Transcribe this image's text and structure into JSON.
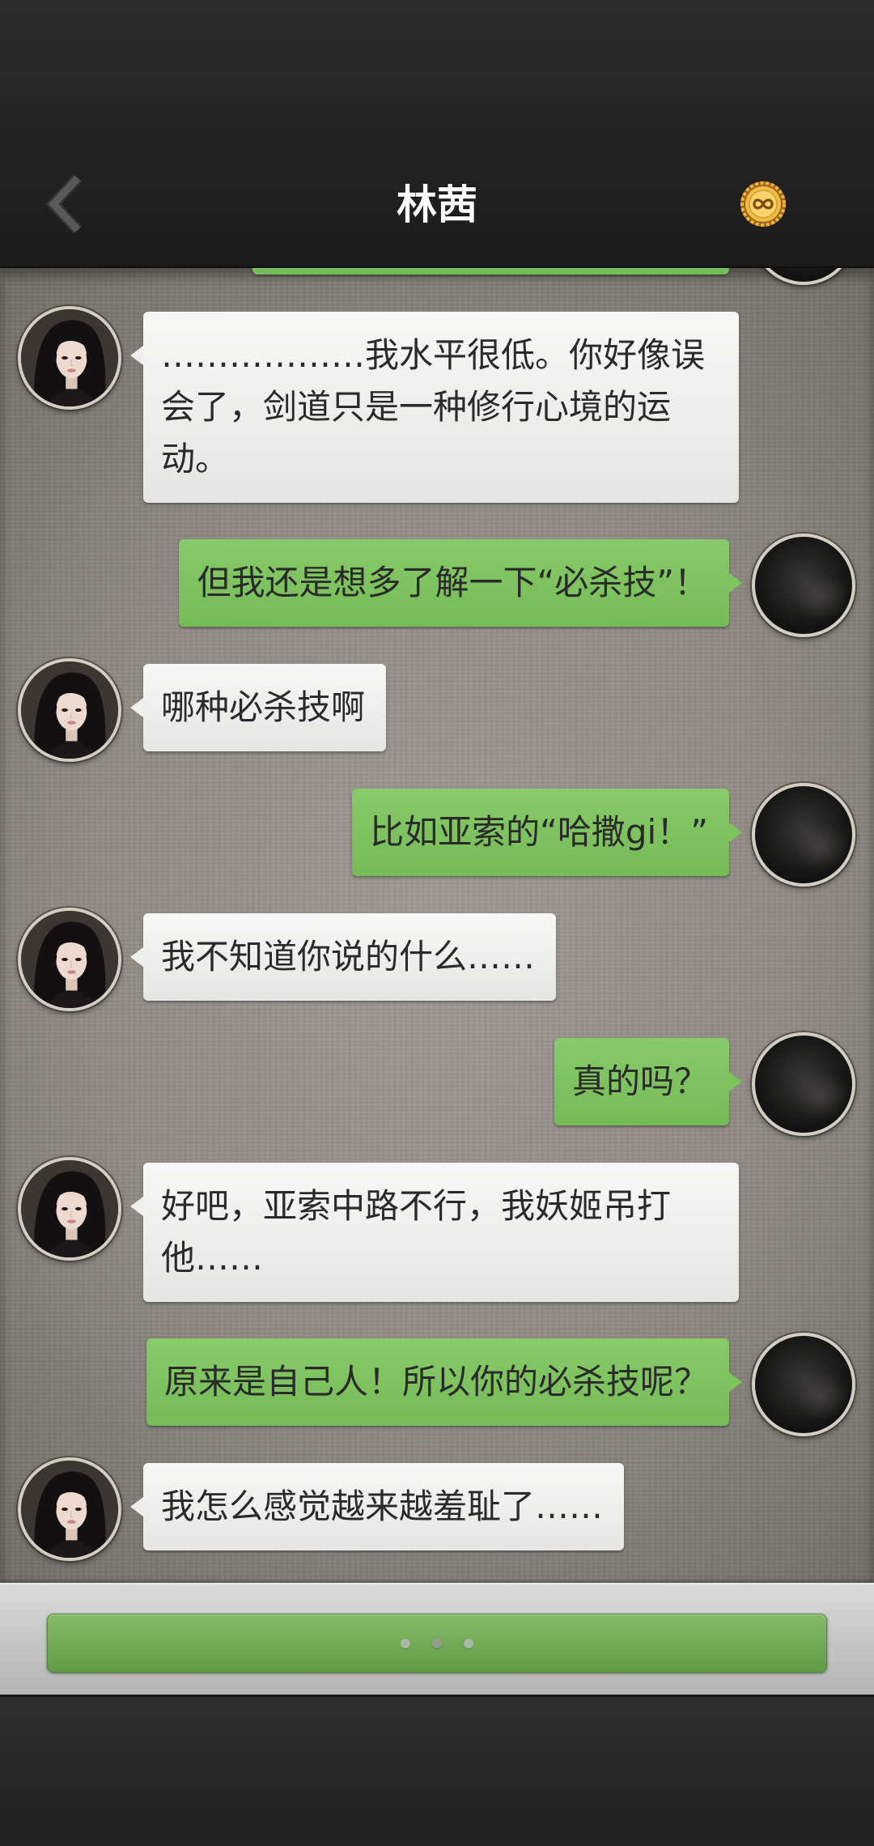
{
  "header": {
    "title": "林茜",
    "back_icon": "chevron-left-icon",
    "action_icon": "gold-coin-infinity-icon"
  },
  "avatars": {
    "contact_icon": "woman-portrait-avatar",
    "me_icon": "dark-photo-avatar"
  },
  "messages": [
    {
      "from": "me",
      "cut_off": true
    },
    {
      "from": "contact",
      "text": "………………我水平很低。你好像误会了，剑道只是一种修行心境的运动。"
    },
    {
      "from": "me",
      "text": "但我还是想多了解一下“必杀技”！"
    },
    {
      "from": "contact",
      "text": "哪种必杀技啊"
    },
    {
      "from": "me",
      "text": "比如亚索的“哈撒gi！”"
    },
    {
      "from": "contact",
      "text": "我不知道你说的什么……"
    },
    {
      "from": "me",
      "text": "真的吗？"
    },
    {
      "from": "contact",
      "text": "好吧，亚索中路不行，我妖姬吊打他……"
    },
    {
      "from": "me",
      "text": "原来是自己人！所以你的必杀技呢？"
    },
    {
      "from": "contact",
      "text": "我怎么感觉越来越羞耻了……"
    }
  ],
  "composer": {
    "state_icon": "typing-dots-icon"
  },
  "colors": {
    "outgoing_bubble": "#7bc55a",
    "incoming_bubble": "#eeeeec",
    "bubble_text": "#2a2a2a",
    "title_text": "#ffffff",
    "header_background": "#222222",
    "typing_bar": "#6dad4c"
  }
}
